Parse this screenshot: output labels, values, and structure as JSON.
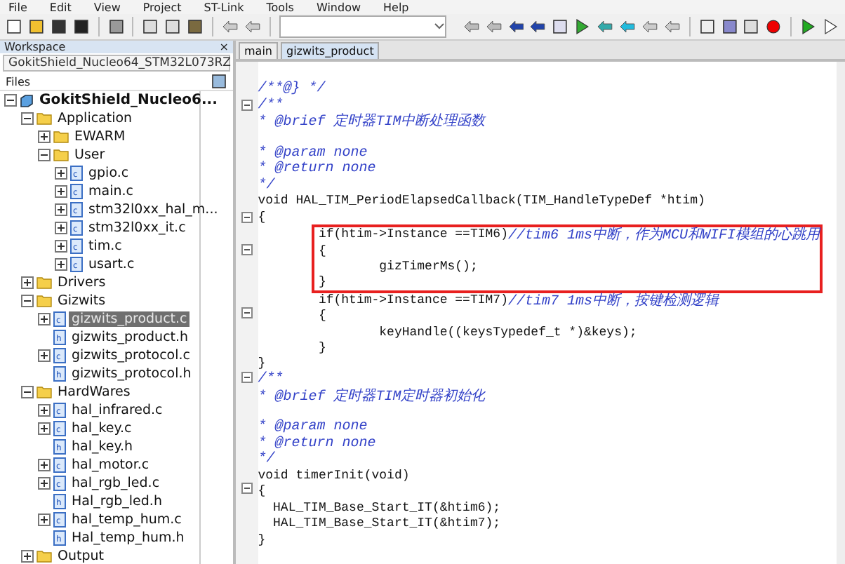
{
  "menu": [
    "File",
    "Edit",
    "View",
    "Project",
    "ST-Link",
    "Tools",
    "Window",
    "Help"
  ],
  "workspace": {
    "title": "Workspace",
    "close": "×",
    "configuration": "GokitShield_Nucleo64_STM32L073RZ",
    "files_header": "Files"
  },
  "tree": [
    {
      "label": "GokitShield_Nucleo6...",
      "kind": "project",
      "expanded": true,
      "selected": false,
      "children": [
        {
          "label": "Application",
          "kind": "folder",
          "expanded": true,
          "selected": false,
          "children": [
            {
              "label": "EWARM",
              "kind": "folder",
              "expanded": false,
              "selected": false
            },
            {
              "label": "User",
              "kind": "folder",
              "expanded": true,
              "selected": false,
              "children": [
                {
                  "label": "gpio.c",
                  "kind": "c",
                  "expanded": false,
                  "selected": false
                },
                {
                  "label": "main.c",
                  "kind": "c",
                  "expanded": false,
                  "selected": false
                },
                {
                  "label": "stm32l0xx_hal_m...",
                  "kind": "c",
                  "expanded": false,
                  "selected": false
                },
                {
                  "label": "stm32l0xx_it.c",
                  "kind": "c",
                  "expanded": false,
                  "selected": false
                },
                {
                  "label": "tim.c",
                  "kind": "c",
                  "expanded": false,
                  "selected": false
                },
                {
                  "label": "usart.c",
                  "kind": "c",
                  "expanded": false,
                  "selected": false
                }
              ]
            }
          ]
        },
        {
          "label": "Drivers",
          "kind": "folder",
          "expanded": false,
          "selected": false
        },
        {
          "label": "Gizwits",
          "kind": "folder",
          "expanded": true,
          "selected": false,
          "children": [
            {
              "label": "gizwits_product.c",
              "kind": "c",
              "expanded": false,
              "selected": true
            },
            {
              "label": "gizwits_product.h",
              "kind": "h",
              "selected": false
            },
            {
              "label": "gizwits_protocol.c",
              "kind": "c",
              "expanded": false,
              "selected": false
            },
            {
              "label": "gizwits_protocol.h",
              "kind": "h",
              "selected": false
            }
          ]
        },
        {
          "label": "HardWares",
          "kind": "folder",
          "expanded": true,
          "selected": false,
          "children": [
            {
              "label": "hal_infrared.c",
              "kind": "c",
              "expanded": false,
              "selected": false
            },
            {
              "label": "hal_key.c",
              "kind": "c",
              "expanded": false,
              "selected": false
            },
            {
              "label": "hal_key.h",
              "kind": "h",
              "selected": false
            },
            {
              "label": "hal_motor.c",
              "kind": "c",
              "expanded": false,
              "selected": false
            },
            {
              "label": "hal_rgb_led.c",
              "kind": "c",
              "expanded": false,
              "selected": false
            },
            {
              "label": "Hal_rgb_led.h",
              "kind": "h",
              "selected": false
            },
            {
              "label": "hal_temp_hum.c",
              "kind": "c",
              "expanded": false,
              "selected": false
            },
            {
              "label": "Hal_temp_hum.h",
              "kind": "h",
              "selected": false
            }
          ]
        },
        {
          "label": "Output",
          "kind": "folder",
          "expanded": false,
          "selected": false
        }
      ]
    }
  ],
  "tabs": [
    {
      "label": "main",
      "selected": false
    },
    {
      "label": "gizwits_product",
      "selected": true
    }
  ],
  "code": [
    {
      "comment": "/**@} */"
    },
    {
      "comment": "/**",
      "fold": true
    },
    {
      "comment": "* @brief 定时器TIM中断处理函数"
    },
    {
      "comment": "* @param none",
      "blank_before": true
    },
    {
      "comment": "* @return none"
    },
    {
      "comment": "*/"
    },
    {
      "code": "void HAL_TIM_PeriodElapsedCallback(TIM_HandleTypeDef *htim)"
    },
    {
      "code": "{",
      "fold": true
    },
    {
      "code": "        if(htim->Instance ==TIM6)",
      "comment": "//tim6 1ms中断，作为MCU和WIFI模组的心跳用",
      "highlight": true
    },
    {
      "code": "        {",
      "fold": true,
      "highlight": true
    },
    {
      "code": "                gizTimerMs();",
      "highlight": true
    },
    {
      "code": "        }",
      "highlight": true
    },
    {
      "code": "        if(htim->Instance ==TIM7)",
      "comment": "//tim7 1ms中断，按键检测逻辑"
    },
    {
      "code": "        {",
      "fold": true
    },
    {
      "code": "                keyHandle((keysTypedef_t *)&keys);"
    },
    {
      "code": "        }"
    },
    {
      "code": "}"
    },
    {
      "comment": "/**",
      "fold": true
    },
    {
      "comment": "* @brief 定时器TIM定时器初始化"
    },
    {
      "comment": "* @param none",
      "blank_before": true
    },
    {
      "comment": "* @return none"
    },
    {
      "comment": "*/"
    },
    {
      "code": "void timerInit(void)"
    },
    {
      "code": "{",
      "fold": true
    },
    {
      "code": "  HAL_TIM_Base_Start_IT(&htim6);"
    },
    {
      "code": "  HAL_TIM_Base_Start_IT(&htim7);"
    },
    {
      "code": "}"
    }
  ]
}
